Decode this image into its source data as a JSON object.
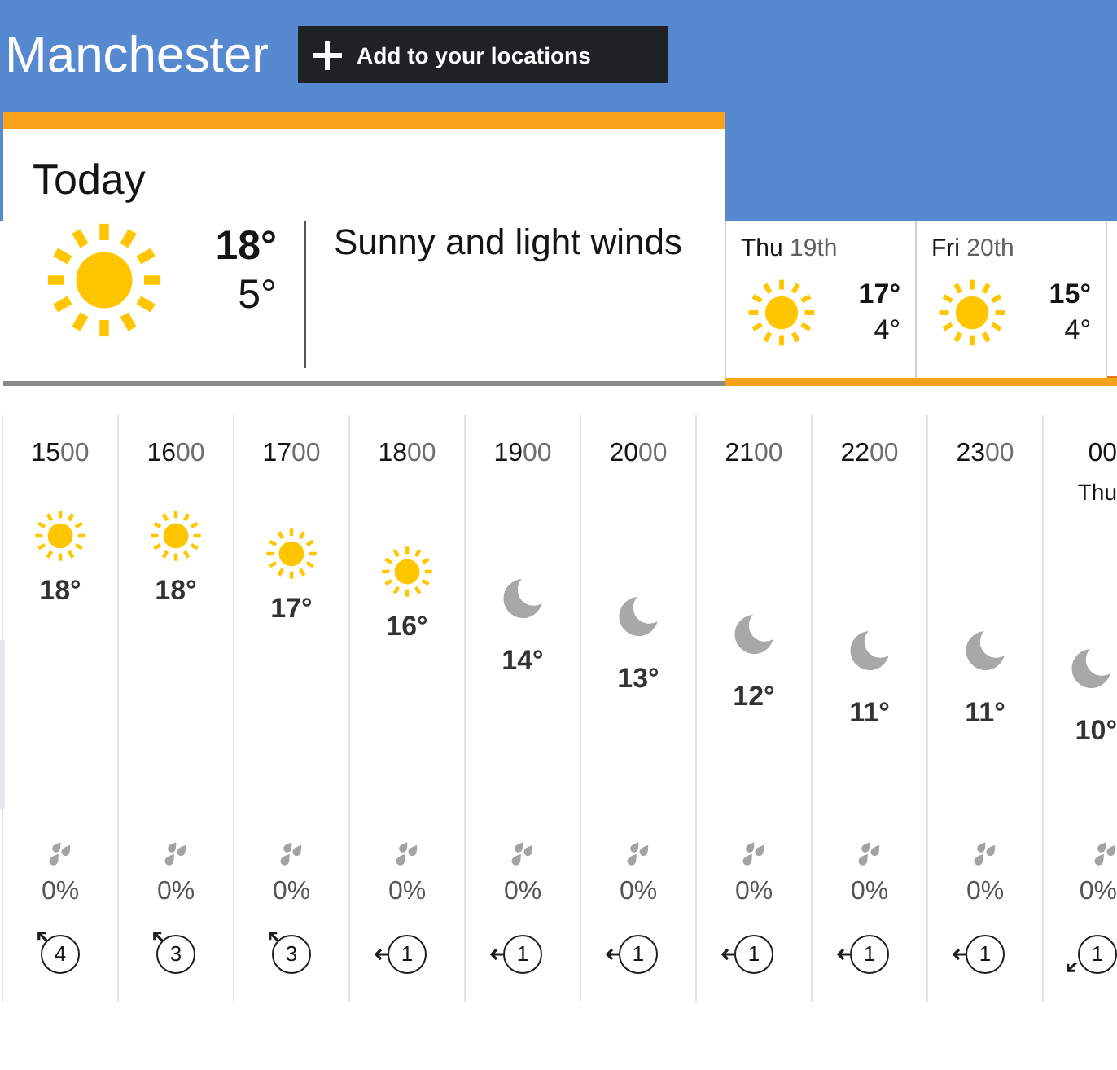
{
  "location": {
    "title": "Manchester",
    "add_button": "Add to your locations"
  },
  "days": [
    {
      "label": "Today",
      "kind": "sunny",
      "high": "18°",
      "low": "5°",
      "summary": "Sunny and light winds",
      "selected": true
    },
    {
      "day": "Thu",
      "date": "19th",
      "kind": "sunny",
      "high": "17°",
      "low": "4°",
      "selected": false
    },
    {
      "day": "Fri",
      "date": "20th",
      "kind": "sunny",
      "high": "15°",
      "low": "4°",
      "selected": false
    }
  ],
  "hours": [
    {
      "hour": "15",
      "minutes": "00",
      "kind": "sunny",
      "temperature": "18°",
      "rain_chance": "0%",
      "wind": {
        "speed": "4",
        "kind": "nw"
      }
    },
    {
      "hour": "16",
      "minutes": "00",
      "kind": "sunny",
      "temperature": "18°",
      "rain_chance": "0%",
      "wind": {
        "speed": "3",
        "kind": "nw"
      }
    },
    {
      "hour": "17",
      "minutes": "00",
      "kind": "sunny",
      "temperature": "17°",
      "rain_chance": "0%",
      "wind": {
        "speed": "3",
        "kind": "nw"
      }
    },
    {
      "hour": "18",
      "minutes": "00",
      "kind": "sunny",
      "temperature": "16°",
      "rain_chance": "0%",
      "wind": {
        "speed": "1",
        "kind": "w"
      }
    },
    {
      "hour": "19",
      "minutes": "00",
      "kind": "clear",
      "temperature": "14°",
      "rain_chance": "0%",
      "wind": {
        "speed": "1",
        "kind": "w"
      }
    },
    {
      "hour": "20",
      "minutes": "00",
      "kind": "clear",
      "temperature": "13°",
      "rain_chance": "0%",
      "wind": {
        "speed": "1",
        "kind": "w"
      }
    },
    {
      "hour": "21",
      "minutes": "00",
      "kind": "clear",
      "temperature": "12°",
      "rain_chance": "0%",
      "wind": {
        "speed": "1",
        "kind": "w"
      }
    },
    {
      "hour": "22",
      "minutes": "00",
      "kind": "clear",
      "temperature": "11°",
      "rain_chance": "0%",
      "wind": {
        "speed": "1",
        "kind": "w"
      }
    },
    {
      "hour": "23",
      "minutes": "00",
      "kind": "clear",
      "temperature": "11°",
      "rain_chance": "0%",
      "wind": {
        "speed": "1",
        "kind": "w"
      }
    },
    {
      "hour": "00",
      "day_marker": "Thu",
      "kind": "clear",
      "temperature": "10°",
      "rain_chance": "0%",
      "wind": {
        "speed": "1",
        "kind": "sw"
      }
    }
  ]
}
